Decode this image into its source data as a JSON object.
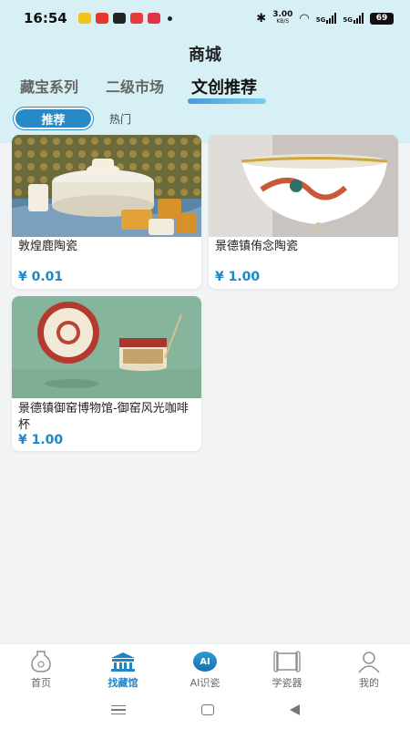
{
  "status_bar": {
    "time": "16:54",
    "network_speed": "3.00",
    "network_unit": "KB/S",
    "signal1": "5G",
    "signal2": "5G",
    "battery": "69"
  },
  "header": {
    "title": "商城",
    "tabs": [
      {
        "label": "藏宝系列"
      },
      {
        "label": "二级市场"
      },
      {
        "label": "文创推荐"
      }
    ],
    "subtabs": [
      {
        "label": "推荐"
      },
      {
        "label": "热门"
      }
    ]
  },
  "products": [
    {
      "name": "敦煌鹿陶瓷",
      "price": "¥ 0.01"
    },
    {
      "name": "景德镇侑念陶瓷",
      "price": "¥ 1.00"
    },
    {
      "name": "景德镇御窑博物馆-御窑风光咖啡杯",
      "price": "¥ 1.00"
    }
  ],
  "bottom_nav": [
    {
      "label": "首页",
      "icon": "home-vase-icon"
    },
    {
      "label": "找藏馆",
      "icon": "museum-icon"
    },
    {
      "label": "AI识瓷",
      "icon": "ai-badge-icon",
      "badge": "AI"
    },
    {
      "label": "学瓷器",
      "icon": "scroll-icon"
    },
    {
      "label": "我的",
      "icon": "profile-icon"
    }
  ],
  "colors": {
    "accent": "#1f86c8",
    "header_bg": "#d6f0f5",
    "page_bg": "#f1f3f4"
  }
}
